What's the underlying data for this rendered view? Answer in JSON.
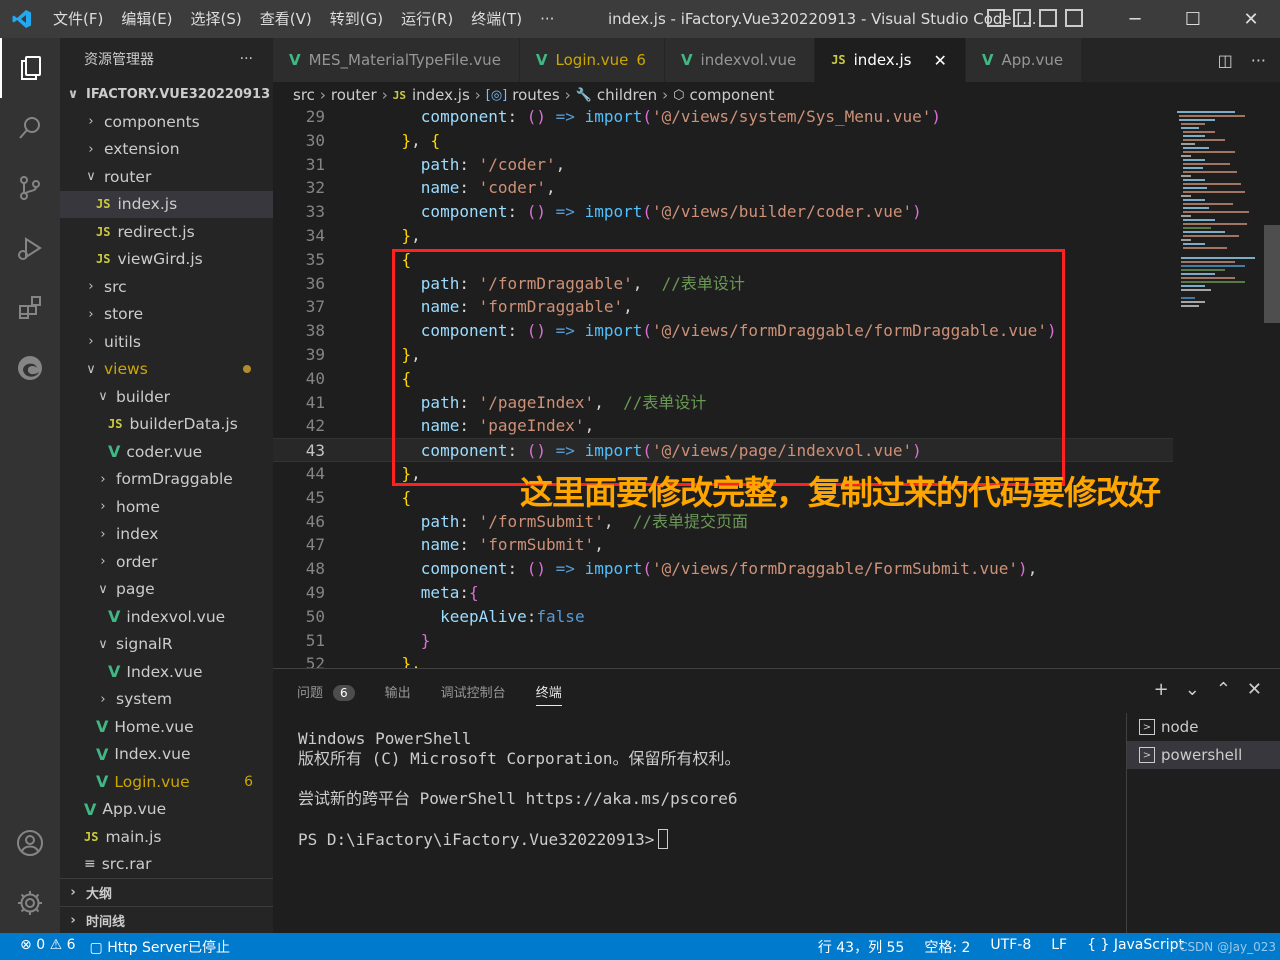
{
  "titlebar": {
    "menus": [
      "文件(F)",
      "编辑(E)",
      "选择(S)",
      "查看(V)",
      "转到(G)",
      "运行(R)",
      "终端(T)",
      "···"
    ],
    "title": "index.js - iFactory.Vue320220913 - Visual Studio Code [..."
  },
  "sidebar": {
    "header": "资源管理器",
    "more": "···",
    "project": "IFACTORY.VUE320220913",
    "items": [
      {
        "label": "components",
        "kind": "folder-closed",
        "indent": 1
      },
      {
        "label": "extension",
        "kind": "folder-closed",
        "indent": 1
      },
      {
        "label": "router",
        "kind": "folder-open",
        "indent": 1
      },
      {
        "label": "index.js",
        "kind": "js",
        "indent": 2,
        "selected": true
      },
      {
        "label": "redirect.js",
        "kind": "js",
        "indent": 2
      },
      {
        "label": "viewGird.js",
        "kind": "js",
        "indent": 2
      },
      {
        "label": "src",
        "kind": "folder-closed",
        "indent": 1
      },
      {
        "label": "store",
        "kind": "folder-closed",
        "indent": 1
      },
      {
        "label": "uitils",
        "kind": "folder-closed",
        "indent": 1
      },
      {
        "label": "views",
        "kind": "folder-open",
        "indent": 1,
        "warn": true,
        "dot": true
      },
      {
        "label": "builder",
        "kind": "folder-open",
        "indent": 2
      },
      {
        "label": "builderData.js",
        "kind": "js",
        "indent": 3
      },
      {
        "label": "coder.vue",
        "kind": "vue",
        "indent": 3
      },
      {
        "label": "formDraggable",
        "kind": "folder-closed",
        "indent": 2
      },
      {
        "label": "home",
        "kind": "folder-closed",
        "indent": 2
      },
      {
        "label": "index",
        "kind": "folder-closed",
        "indent": 2
      },
      {
        "label": "order",
        "kind": "folder-closed",
        "indent": 2
      },
      {
        "label": "page",
        "kind": "folder-open",
        "indent": 2
      },
      {
        "label": "indexvol.vue",
        "kind": "vue",
        "indent": 3
      },
      {
        "label": "signalR",
        "kind": "folder-open",
        "indent": 2
      },
      {
        "label": "Index.vue",
        "kind": "vue",
        "indent": 3
      },
      {
        "label": "system",
        "kind": "folder-closed",
        "indent": 2
      },
      {
        "label": "Home.vue",
        "kind": "vue",
        "indent": 2
      },
      {
        "label": "Index.vue",
        "kind": "vue",
        "indent": 2
      },
      {
        "label": "Login.vue",
        "kind": "vue",
        "indent": 2,
        "warn": true,
        "count": "6"
      },
      {
        "label": "App.vue",
        "kind": "vue",
        "indent": 1
      },
      {
        "label": "main.js",
        "kind": "js",
        "indent": 1
      },
      {
        "label": "src.rar",
        "kind": "file",
        "indent": 1
      }
    ],
    "outline": "大纲",
    "timeline": "时间线"
  },
  "tabs": [
    {
      "label": "MES_MaterialTypeFile.vue",
      "kind": "vue"
    },
    {
      "label": "Login.vue",
      "kind": "vue",
      "warn": true,
      "count": "6"
    },
    {
      "label": "indexvol.vue",
      "kind": "vue"
    },
    {
      "label": "index.js",
      "kind": "js",
      "active": true
    },
    {
      "label": "App.vue",
      "kind": "vue"
    }
  ],
  "breadcrumb": [
    "src",
    "router",
    "index.js",
    "routes",
    "children",
    "component"
  ],
  "editor": {
    "current_line": 43,
    "lines": [
      {
        "n": "29",
        "tokens": [
          [
            "pn",
            "      "
          ],
          [
            "key",
            "component"
          ],
          [
            "pn",
            ": "
          ],
          [
            "b2",
            "()"
          ],
          [
            "kw",
            " => "
          ],
          [
            "fn",
            "import"
          ],
          [
            "b2",
            "("
          ],
          [
            "str",
            "'@/views/system/Sys_Menu.vue'"
          ],
          [
            "b2",
            ")"
          ]
        ]
      },
      {
        "n": "30",
        "tokens": [
          [
            "pn",
            "    "
          ],
          [
            "b1",
            "}"
          ],
          [
            "pn",
            ", "
          ],
          [
            "b1",
            "{"
          ]
        ]
      },
      {
        "n": "31",
        "tokens": [
          [
            "pn",
            "      "
          ],
          [
            "key",
            "path"
          ],
          [
            "pn",
            ": "
          ],
          [
            "str",
            "'/coder'"
          ],
          [
            "pn",
            ","
          ]
        ]
      },
      {
        "n": "32",
        "tokens": [
          [
            "pn",
            "      "
          ],
          [
            "key",
            "name"
          ],
          [
            "pn",
            ": "
          ],
          [
            "str",
            "'coder'"
          ],
          [
            "pn",
            ","
          ]
        ]
      },
      {
        "n": "33",
        "tokens": [
          [
            "pn",
            "      "
          ],
          [
            "key",
            "component"
          ],
          [
            "pn",
            ": "
          ],
          [
            "b2",
            "()"
          ],
          [
            "kw",
            " => "
          ],
          [
            "fn",
            "import"
          ],
          [
            "b2",
            "("
          ],
          [
            "str",
            "'@/views/builder/coder.vue'"
          ],
          [
            "b2",
            ")"
          ]
        ]
      },
      {
        "n": "34",
        "tokens": [
          [
            "pn",
            "    "
          ],
          [
            "b1",
            "}"
          ],
          [
            "pn",
            ","
          ]
        ]
      },
      {
        "n": "35",
        "tokens": [
          [
            "pn",
            "    "
          ],
          [
            "b1",
            "{"
          ]
        ]
      },
      {
        "n": "36",
        "tokens": [
          [
            "pn",
            "      "
          ],
          [
            "key",
            "path"
          ],
          [
            "pn",
            ": "
          ],
          [
            "str",
            "'/formDraggable'"
          ],
          [
            "pn",
            ",  "
          ],
          [
            "com",
            "//表单设计"
          ]
        ]
      },
      {
        "n": "37",
        "tokens": [
          [
            "pn",
            "      "
          ],
          [
            "key",
            "name"
          ],
          [
            "pn",
            ": "
          ],
          [
            "str",
            "'formDraggable'"
          ],
          [
            "pn",
            ","
          ]
        ]
      },
      {
        "n": "38",
        "tokens": [
          [
            "pn",
            "      "
          ],
          [
            "key",
            "component"
          ],
          [
            "pn",
            ": "
          ],
          [
            "b2",
            "()"
          ],
          [
            "kw",
            " => "
          ],
          [
            "fn",
            "import"
          ],
          [
            "b2",
            "("
          ],
          [
            "str",
            "'@/views/formDraggable/formDraggable.vue'"
          ],
          [
            "b2",
            ")"
          ]
        ]
      },
      {
        "n": "39",
        "tokens": [
          [
            "pn",
            "    "
          ],
          [
            "b1",
            "}"
          ],
          [
            "pn",
            ","
          ]
        ]
      },
      {
        "n": "40",
        "tokens": [
          [
            "pn",
            "    "
          ],
          [
            "b1",
            "{"
          ]
        ]
      },
      {
        "n": "41",
        "tokens": [
          [
            "pn",
            "      "
          ],
          [
            "key",
            "path"
          ],
          [
            "pn",
            ": "
          ],
          [
            "str",
            "'/pageIndex'"
          ],
          [
            "pn",
            ",  "
          ],
          [
            "com",
            "//表单设计"
          ]
        ]
      },
      {
        "n": "42",
        "tokens": [
          [
            "pn",
            "      "
          ],
          [
            "key",
            "name"
          ],
          [
            "pn",
            ": "
          ],
          [
            "str",
            "'pageIndex'"
          ],
          [
            "pn",
            ","
          ]
        ]
      },
      {
        "n": "43",
        "tokens": [
          [
            "pn",
            "      "
          ],
          [
            "key",
            "component"
          ],
          [
            "pn",
            ": "
          ],
          [
            "b2",
            "()"
          ],
          [
            "kw",
            " => "
          ],
          [
            "fn",
            "import"
          ],
          [
            "b2",
            "("
          ],
          [
            "str",
            "'@/views/page/indexvol.vue'"
          ],
          [
            "b2",
            ")"
          ]
        ]
      },
      {
        "n": "44",
        "tokens": [
          [
            "pn",
            "    "
          ],
          [
            "b1",
            "}"
          ],
          [
            "pn",
            ","
          ]
        ]
      },
      {
        "n": "45",
        "tokens": [
          [
            "pn",
            "    "
          ],
          [
            "b1",
            "{"
          ]
        ]
      },
      {
        "n": "46",
        "tokens": [
          [
            "pn",
            "      "
          ],
          [
            "key",
            "path"
          ],
          [
            "pn",
            ": "
          ],
          [
            "str",
            "'/formSubmit'"
          ],
          [
            "pn",
            ",  "
          ],
          [
            "com",
            "//表单提交页面"
          ]
        ]
      },
      {
        "n": "47",
        "tokens": [
          [
            "pn",
            "      "
          ],
          [
            "key",
            "name"
          ],
          [
            "pn",
            ": "
          ],
          [
            "str",
            "'formSubmit'"
          ],
          [
            "pn",
            ","
          ]
        ]
      },
      {
        "n": "48",
        "tokens": [
          [
            "pn",
            "      "
          ],
          [
            "key",
            "component"
          ],
          [
            "pn",
            ": "
          ],
          [
            "b2",
            "()"
          ],
          [
            "kw",
            " => "
          ],
          [
            "fn",
            "import"
          ],
          [
            "b2",
            "("
          ],
          [
            "str",
            "'@/views/formDraggable/FormSubmit.vue'"
          ],
          [
            "b2",
            ")"
          ],
          [
            "pn",
            ","
          ]
        ]
      },
      {
        "n": "49",
        "tokens": [
          [
            "pn",
            "      "
          ],
          [
            "key",
            "meta"
          ],
          [
            "pn",
            ":"
          ],
          [
            "b2",
            "{"
          ]
        ]
      },
      {
        "n": "50",
        "tokens": [
          [
            "pn",
            "        "
          ],
          [
            "key",
            "keepAlive"
          ],
          [
            "pn",
            ":"
          ],
          [
            "kw",
            "false"
          ]
        ]
      },
      {
        "n": "51",
        "tokens": [
          [
            "pn",
            "      "
          ],
          [
            "b2",
            "}"
          ]
        ]
      },
      {
        "n": "52",
        "tokens": [
          [
            "pn",
            "    "
          ],
          [
            "b1",
            "},"
          ]
        ]
      }
    ],
    "annotation": "这里面要修改完整，复制过来的代码要修改好"
  },
  "panel": {
    "tabs": [
      {
        "label": "问题",
        "badge": "6"
      },
      {
        "label": "输出"
      },
      {
        "label": "调试控制台"
      },
      {
        "label": "终端",
        "active": true
      }
    ],
    "terminal_lines": [
      "Windows PowerShell",
      "版权所有 (C) Microsoft Corporation。保留所有权利。",
      "",
      "尝试新的跨平台 PowerShell https://aka.ms/pscore6",
      "",
      "PS D:\\iFactory\\iFactory.Vue320220913>"
    ],
    "terminals": [
      {
        "label": "node"
      },
      {
        "label": "powershell",
        "selected": true
      }
    ]
  },
  "statusbar": {
    "errors": "0",
    "warnings": "6",
    "server": "Http Server已停止",
    "position": "行 43，列 55",
    "spaces": "空格: 2",
    "encoding": "UTF-8",
    "eol": "LF",
    "language": "JavaScript",
    "watermark": "CSDN @Jay_023"
  }
}
